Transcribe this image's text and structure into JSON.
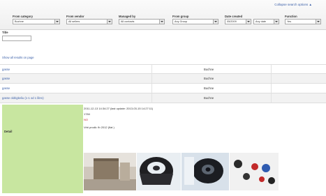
{
  "filters": {
    "collapse_link": "Collapse search options ▲",
    "fields": [
      {
        "label": "From category",
        "value": "Buchne"
      },
      {
        "label": "From vendor",
        "value": "All sellers"
      },
      {
        "label": "Managed by",
        "value": "All contacts"
      },
      {
        "label": "From group",
        "value": "Any Group"
      },
      {
        "label": "Date created",
        "value": "05/2009",
        "value2": "Any date"
      },
      {
        "label": "Function",
        "value": "Yes"
      }
    ],
    "search_label": "Title"
  },
  "list": {
    "show_all_link": "Show all results on page",
    "rows": [
      {
        "name": "gasse",
        "category": "Buchne"
      },
      {
        "name": "gasse",
        "category": "Buchne"
      },
      {
        "name": "gasse",
        "category": "Buchne"
      },
      {
        "name": "gasse oldrigkeliu (1-1 od 1 libro)",
        "category": "Buchne"
      }
    ]
  },
  "detail": {
    "label": "Detail",
    "created": "2011-12-13 14:34:27 (last update: 2013-03-15 14:27:11)",
    "code": "1784",
    "flag": "NO",
    "note": "Vrbi prodk: fb 2012 (flat )"
  },
  "colors": {
    "accent_link": "#3a5fa8",
    "detail_panel": "#c8e6a0",
    "flag_red": "#c0282a"
  }
}
